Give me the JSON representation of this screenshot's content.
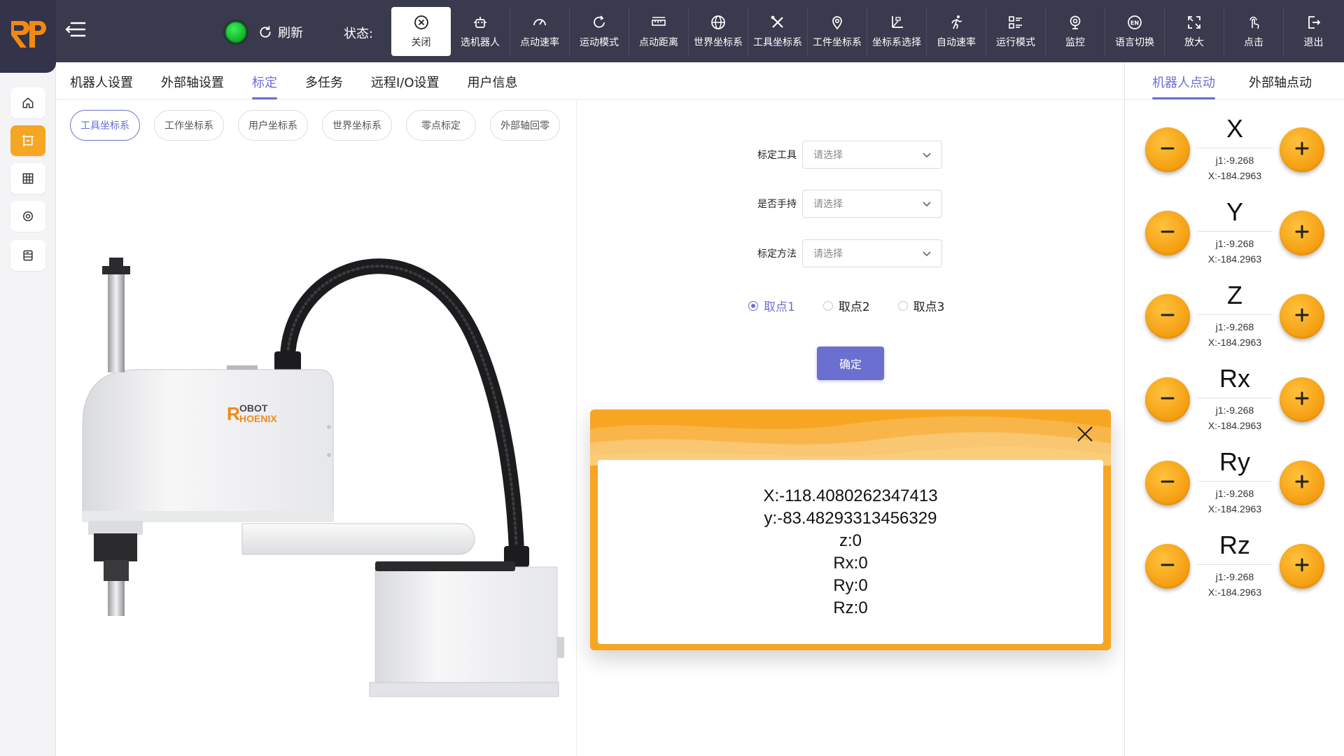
{
  "topbar": {
    "refresh_label": "刷新",
    "status_label": "状态:",
    "tools": [
      {
        "label": "关闭",
        "icon": "close-circle-icon",
        "active": true
      },
      {
        "label": "选机器人",
        "icon": "robot-icon"
      },
      {
        "label": "点动速率",
        "icon": "speedometer-icon"
      },
      {
        "label": "运动模式",
        "icon": "cycle-icon"
      },
      {
        "label": "点动距离",
        "icon": "ruler-icon"
      },
      {
        "label": "世界坐标系",
        "icon": "globe-icon"
      },
      {
        "label": "工具坐标系",
        "icon": "tools-icon"
      },
      {
        "label": "工件坐标系",
        "icon": "location-pin-icon"
      },
      {
        "label": "坐标系选择",
        "icon": "axis-icon"
      },
      {
        "label": "自动速率",
        "icon": "running-icon"
      },
      {
        "label": "运行模式",
        "icon": "list-icon"
      },
      {
        "label": "监控",
        "icon": "webcam-icon"
      },
      {
        "label": "语言切换",
        "icon": "language-icon"
      },
      {
        "label": "放大",
        "icon": "expand-icon"
      },
      {
        "label": "点击",
        "icon": "tap-icon"
      },
      {
        "label": "退出",
        "icon": "exit-icon"
      }
    ]
  },
  "sidebar": {
    "items": [
      {
        "icon": "home-icon"
      },
      {
        "icon": "calibration-icon",
        "active": true
      },
      {
        "icon": "grid-icon"
      },
      {
        "icon": "settings-icon"
      },
      {
        "icon": "database-icon"
      }
    ]
  },
  "main_tabs": [
    "机器人设置",
    "外部轴设置",
    "标定",
    "多任务",
    "远程I/O设置",
    "用户信息"
  ],
  "main_tab_active": 2,
  "sub_tabs": [
    "工具坐标系",
    "工作坐标系",
    "用户坐标系",
    "世界坐标系",
    "零点标定",
    "外部轴回零"
  ],
  "sub_tab_active": 0,
  "robot_logo": {
    "line1": "OBOT",
    "line2": "HOENIX"
  },
  "form": {
    "fields": [
      {
        "label": "标定工具",
        "placeholder": "请选择"
      },
      {
        "label": "是否手持",
        "placeholder": "请选择"
      },
      {
        "label": "标定方法",
        "placeholder": "请选择"
      }
    ],
    "radios": [
      {
        "label": "取点1",
        "checked": true
      },
      {
        "label": "取点2",
        "checked": false
      },
      {
        "label": "取点3",
        "checked": false
      }
    ],
    "confirm_label": "确定"
  },
  "dialog": {
    "lines": [
      "X:-118.4080262347413",
      "y:-83.48293313456329",
      "z:0",
      "Rx:0",
      "Ry:0",
      "Rz:0"
    ]
  },
  "right_panel": {
    "tabs": [
      "机器人点动",
      "外部轴点动"
    ],
    "active_tab": 0,
    "axes": [
      {
        "name": "X",
        "j_value": "j1:-9.268",
        "x_value": "X:-184.2963"
      },
      {
        "name": "Y",
        "j_value": "j1:-9.268",
        "x_value": "X:-184.2963"
      },
      {
        "name": "Z",
        "j_value": "j1:-9.268",
        "x_value": "X:-184.2963"
      },
      {
        "name": "Rx",
        "j_value": "j1:-9.268",
        "x_value": "X:-184.2963"
      },
      {
        "name": "Ry",
        "j_value": "j1:-9.268",
        "x_value": "X:-184.2963"
      },
      {
        "name": "Rz",
        "j_value": "j1:-9.268",
        "x_value": "X:-184.2963"
      }
    ]
  },
  "colors": {
    "topbar": "#3a3a4e",
    "accent": "#6a6fd0",
    "orange": "#f7a623",
    "status_green": "#1fc83a"
  }
}
